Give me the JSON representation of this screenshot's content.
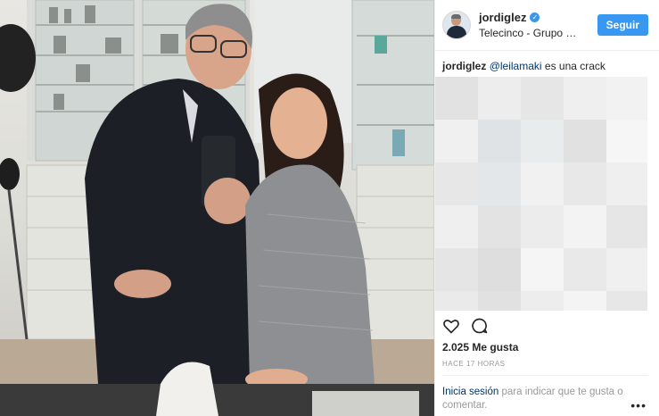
{
  "post": {
    "username": "jordiglez",
    "location": "Telecinco - Grupo …",
    "follow_label": "Seguir",
    "caption_user": "jordiglez",
    "caption_mention": "@leilamaki",
    "caption_text": " es una crack",
    "likes": "2.025 Me gusta",
    "time": "HACE 17 HORAS",
    "login_link": "Inicia sesión",
    "login_text": " para indicar que te gusta o comentar.",
    "more": "•••"
  },
  "icons": [
    "verified-badge-icon",
    "heart-icon",
    "comment-icon",
    "more-options-icon"
  ],
  "colors": {
    "accent": "#3897f0",
    "link": "#003569",
    "muted": "#999999"
  }
}
